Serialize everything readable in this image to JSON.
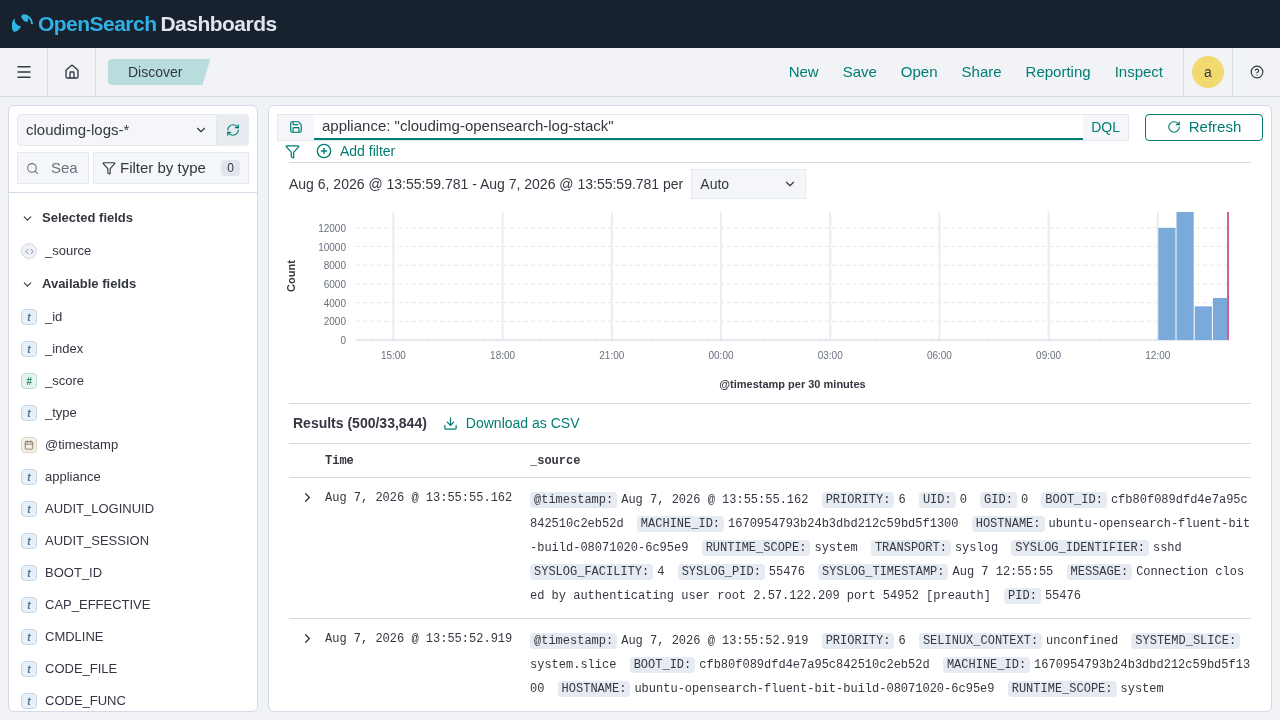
{
  "header": {
    "brand": "OpenSearch",
    "product": "Dashboards"
  },
  "nav": {
    "breadcrumb": "Discover",
    "actions": [
      "New",
      "Save",
      "Open",
      "Share",
      "Reporting",
      "Inspect"
    ],
    "avatar": "a"
  },
  "sidebar": {
    "index_pattern": "cloudimg-logs-*",
    "search": {
      "placeholder": "Sea"
    },
    "filter": {
      "label": "Filter by type",
      "count": "0"
    },
    "sections": [
      {
        "title": "Selected fields",
        "expanded": true,
        "fields": [
          {
            "name": "_source",
            "kind": "source"
          }
        ]
      },
      {
        "title": "Available fields",
        "expanded": true,
        "fields": [
          {
            "name": "_id",
            "kind": "string",
            "glyph": "t"
          },
          {
            "name": "_index",
            "kind": "string",
            "glyph": "t"
          },
          {
            "name": "_score",
            "kind": "number",
            "glyph": "#"
          },
          {
            "name": "_type",
            "kind": "string",
            "glyph": "t"
          },
          {
            "name": "@timestamp",
            "kind": "date"
          },
          {
            "name": "appliance",
            "kind": "string",
            "glyph": "t"
          },
          {
            "name": "AUDIT_LOGINUID",
            "kind": "string",
            "glyph": "t"
          },
          {
            "name": "AUDIT_SESSION",
            "kind": "string",
            "glyph": "t"
          },
          {
            "name": "BOOT_ID",
            "kind": "string",
            "glyph": "t"
          },
          {
            "name": "CAP_EFFECTIVE",
            "kind": "string",
            "glyph": "t"
          },
          {
            "name": "CMDLINE",
            "kind": "string",
            "glyph": "t"
          },
          {
            "name": "CODE_FILE",
            "kind": "string",
            "glyph": "t"
          },
          {
            "name": "CODE_FUNC",
            "kind": "string",
            "glyph": "t"
          }
        ]
      }
    ]
  },
  "query": {
    "value": "appliance: \"cloudimg-opensearch-log-stack\"",
    "language": "DQL",
    "refresh": "Refresh",
    "add_filter": "Add filter"
  },
  "histogram": {
    "range": "Aug 6, 2026 @ 13:55:59.781 - Aug 7, 2026 @ 13:55:59.781 per",
    "interval": "Auto",
    "chart_data": {
      "type": "bar",
      "xlabel": "@timestamp per 30 minutes",
      "ylabel": "Count",
      "categories": [
        null,
        null,
        "15:00",
        null,
        null,
        null,
        null,
        null,
        "18:00",
        null,
        null,
        null,
        null,
        null,
        "21:00",
        null,
        null,
        null,
        null,
        null,
        "00:00",
        null,
        null,
        null,
        null,
        null,
        "03:00",
        null,
        null,
        null,
        null,
        null,
        "06:00",
        null,
        null,
        null,
        null,
        null,
        "09:00",
        null,
        null,
        null,
        null,
        null,
        "12:00",
        null,
        null,
        null
      ],
      "series": [
        {
          "color": "#79aad9",
          "values": [
            null,
            null,
            null,
            null,
            null,
            null,
            null,
            null,
            null,
            null,
            null,
            null,
            null,
            null,
            null,
            null,
            null,
            null,
            null,
            null,
            null,
            null,
            null,
            null,
            null,
            null,
            null,
            null,
            null,
            null,
            null,
            null,
            null,
            null,
            null,
            null,
            null,
            null,
            null,
            null,
            null,
            null,
            null,
            null,
            12000,
            13700,
            3600,
            4500
          ]
        }
      ],
      "ylim": [
        0,
        13700
      ],
      "grid": true,
      "yticks": [
        0,
        2000,
        4000,
        6000,
        8000,
        10000,
        12000
      ]
    }
  },
  "results": {
    "title": "Results (500/33,844)",
    "download": "Download as CSV",
    "columns": [
      "Time",
      "_source"
    ],
    "rows": [
      {
        "time": "Aug 7, 2026 @ 13:55:55.162",
        "fields": [
          {
            "key": "@timestamp:",
            "value": "Aug 7, 2026 @ 13:55:55.162"
          },
          {
            "key": "PRIORITY:",
            "value": "6"
          },
          {
            "key": "UID:",
            "value": "0"
          },
          {
            "key": "GID:",
            "value": "0"
          },
          {
            "key": "BOOT_ID:",
            "value": "cfb80f089dfd4e7a95c842510c2eb52d"
          },
          {
            "key": "MACHINE_ID:",
            "value": "1670954793b24b3dbd212c59bd5f1300"
          },
          {
            "key": "HOSTNAME:",
            "value": "ubuntu-opensearch-fluent-bit-build-08071020-6c95e9"
          },
          {
            "key": "RUNTIME_SCOPE:",
            "value": "system"
          },
          {
            "key": "TRANSPORT:",
            "value": "syslog"
          },
          {
            "key": "SYSLOG_IDENTIFIER:",
            "value": "sshd"
          },
          {
            "key": "SYSLOG_FACILITY:",
            "value": "4"
          },
          {
            "key": "SYSLOG_PID:",
            "value": "55476"
          },
          {
            "key": "SYSLOG_TIMESTAMP:",
            "value": "Aug 7 12:55:55"
          },
          {
            "key": "MESSAGE:",
            "value": "Connection closed by authenticating user root 2.57.122.209 port 54952 [preauth]"
          },
          {
            "key": "PID:",
            "value": "55476"
          }
        ]
      },
      {
        "time": "Aug 7, 2026 @ 13:55:52.919",
        "fields": [
          {
            "key": "@timestamp:",
            "value": "Aug 7, 2026 @ 13:55:52.919"
          },
          {
            "key": "PRIORITY:",
            "value": "6"
          },
          {
            "key": "SELINUX_CONTEXT:",
            "value": "unconfined"
          },
          {
            "key": "SYSTEMD_SLICE:",
            "value": "system.slice"
          },
          {
            "key": "BOOT_ID:",
            "value": "cfb80f089dfd4e7a95c842510c2eb52d"
          },
          {
            "key": "MACHINE_ID:",
            "value": "1670954793b24b3dbd212c59bd5f1300"
          },
          {
            "key": "HOSTNAME:",
            "value": "ubuntu-opensearch-fluent-bit-build-08071020-6c95e9"
          },
          {
            "key": "RUNTIME_SCOPE:",
            "value": "system"
          }
        ]
      }
    ]
  }
}
